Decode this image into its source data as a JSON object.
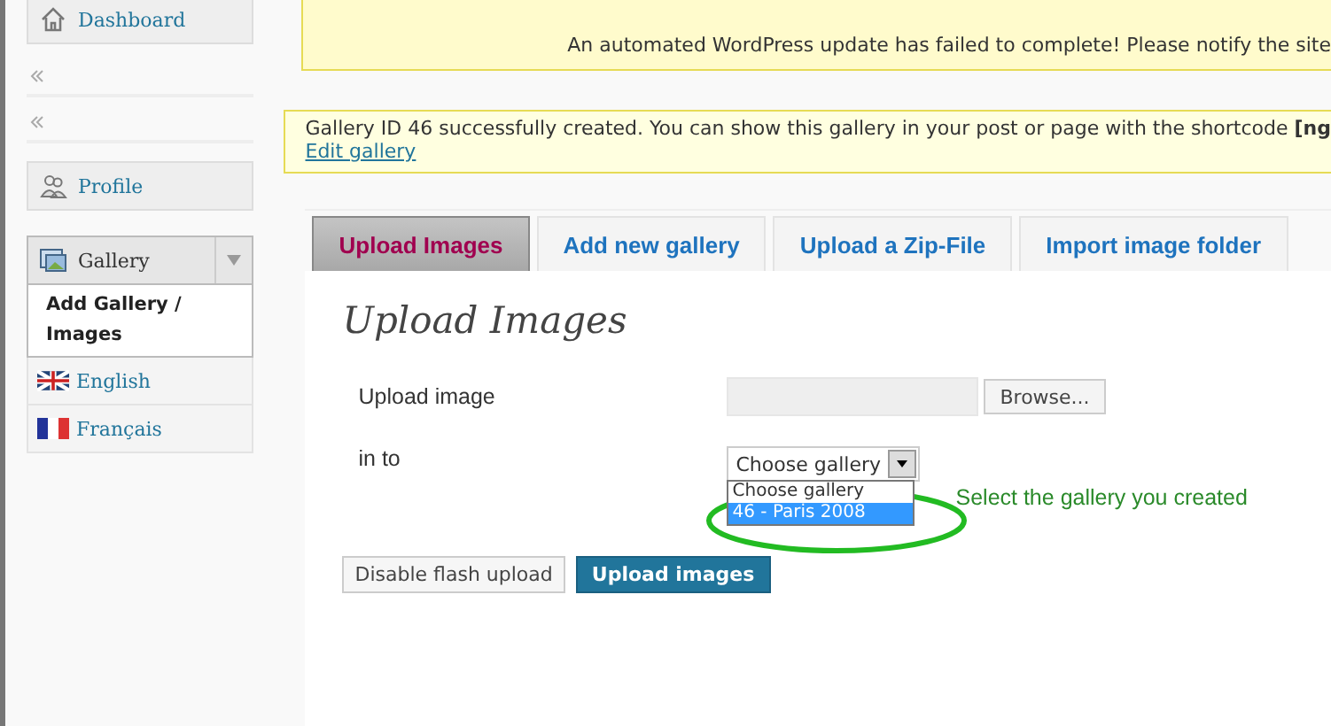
{
  "sidebar": {
    "items": [
      {
        "label": "Dashboard",
        "kind": "menu"
      },
      {
        "kind": "separator"
      },
      {
        "kind": "separator"
      },
      {
        "label": "Profile",
        "kind": "menu"
      }
    ],
    "gallery": {
      "label": "Gallery",
      "expanded": true,
      "submenu": [
        {
          "label": "Add Gallery / Images",
          "selected": true
        }
      ]
    },
    "languages": [
      {
        "label": "English"
      },
      {
        "label": "Français"
      }
    ]
  },
  "update_notice": "An automated WordPress update has failed to complete! Please notify the site",
  "created_notice": {
    "text": "Gallery ID 46 successfully created. You can show this gallery in your post or page with the shortcode **[ng**",
    "link": "Edit gallery"
  },
  "tabs": [
    {
      "label": "Upload Images",
      "selected": true
    },
    {
      "label": "Add new gallery",
      "selected": false
    },
    {
      "label": "Upload a Zip-File",
      "selected": false
    },
    {
      "label": "Import image folder",
      "selected": false
    }
  ],
  "form": {
    "heading": "Upload Images",
    "upload_label": "Upload image",
    "browse_button": "Browse...",
    "into_label": "in to",
    "select_value": "Choose gallery",
    "options": [
      {
        "label": "Choose gallery",
        "selected": false
      },
      {
        "label": "46 - Paris 2008",
        "selected": true
      }
    ],
    "annotation": "Select the gallery you created",
    "buttons": [
      "Disable flash upload",
      "Upload images"
    ]
  }
}
